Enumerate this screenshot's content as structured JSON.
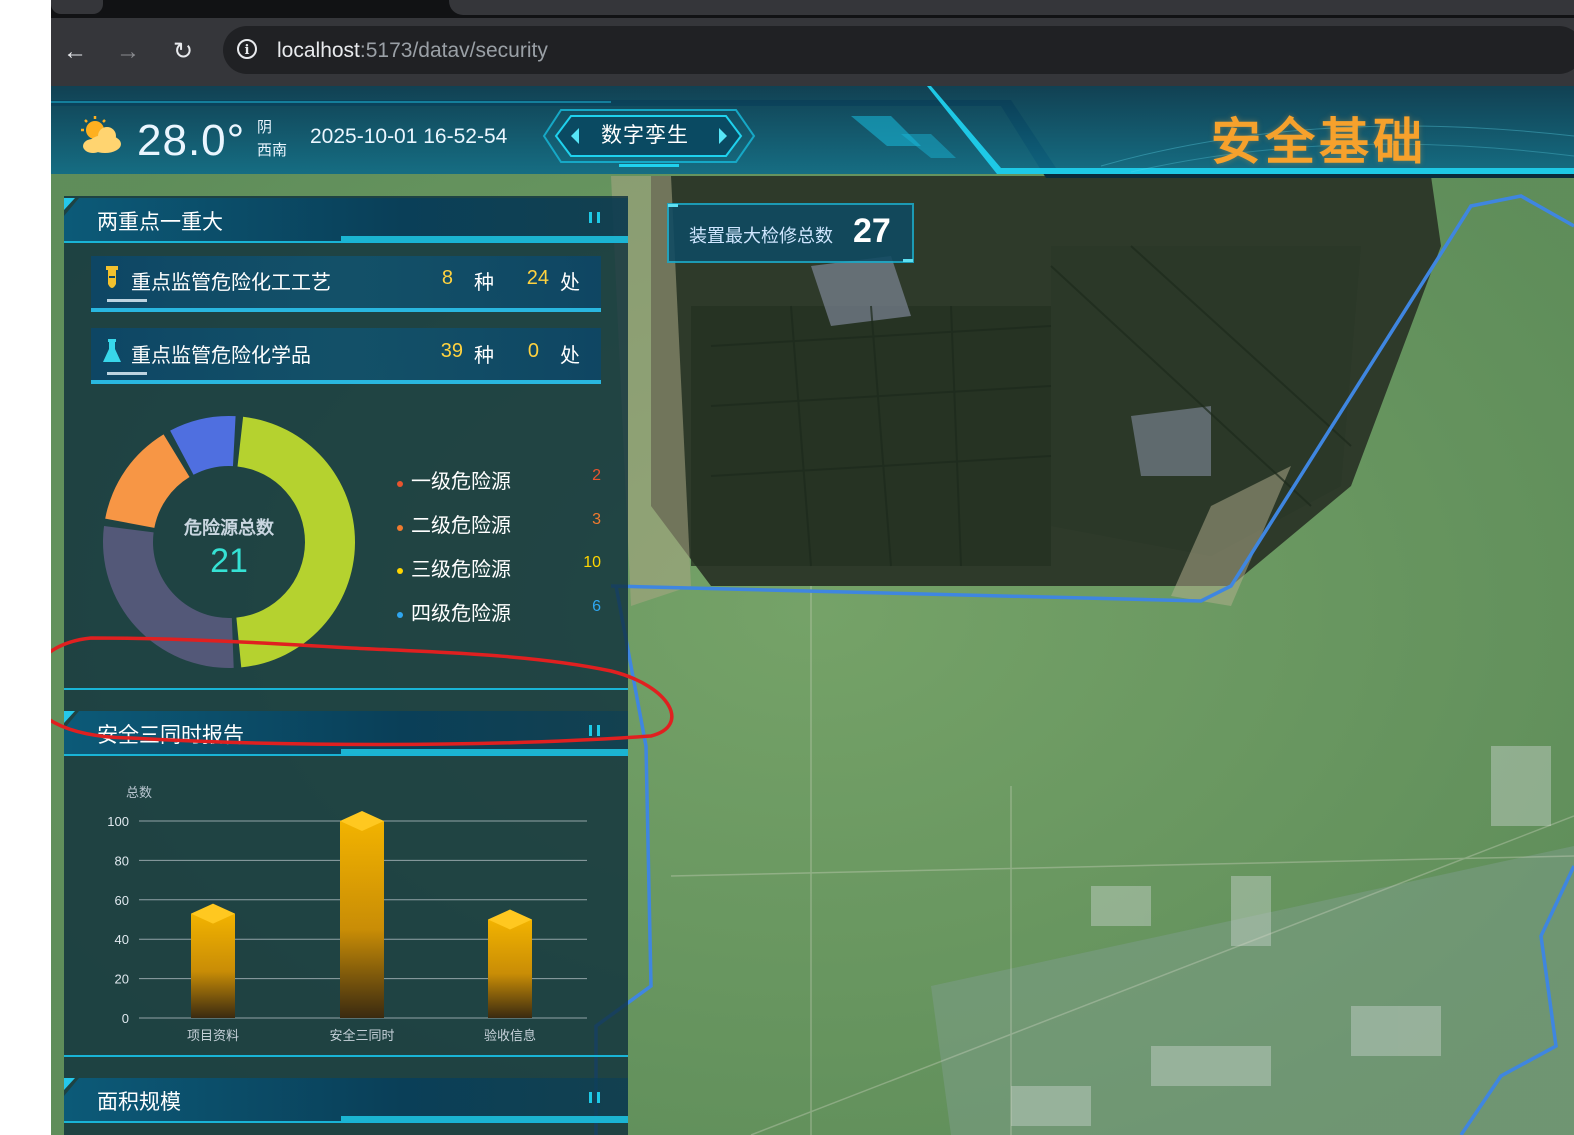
{
  "browser": {
    "url_host": "localhost",
    "url_path": ":5173/datav/security"
  },
  "header": {
    "weather_icon": "partly-cloudy-sun-icon",
    "temperature": "28.0°",
    "weather": "阴",
    "wind": "西南",
    "datetime": "2025-10-01 16-52-54",
    "twin_button": "数字孪生",
    "title": "安全基础"
  },
  "panel1": {
    "title": "两重点一重大",
    "rows": [
      {
        "icon": "test-tube-icon",
        "label": "重点监管危险化工工艺",
        "count1": "8",
        "unit1": "种",
        "count2": "24",
        "unit2": "处"
      },
      {
        "icon": "flask-icon",
        "label": "重点监管危险化学品",
        "count1": "39",
        "unit1": "种",
        "count2": "0",
        "unit2": "处"
      }
    ],
    "donut": {
      "center_label": "危险源总数",
      "center_value": "21",
      "legend": [
        {
          "name": "一级危险源",
          "value": "2",
          "color": "#e8542e"
        },
        {
          "name": "二级危险源",
          "value": "3",
          "color": "#f07a2e"
        },
        {
          "name": "三级危险源",
          "value": "10",
          "color": "#ffd500"
        },
        {
          "name": "四级危险源",
          "value": "6",
          "color": "#2fa6f0"
        }
      ],
      "segment_colors": [
        "#f79645",
        "#4f6fe0",
        "#b5d22f",
        "#535878"
      ]
    }
  },
  "stat": {
    "label": "装置最大检修总数",
    "value": "27"
  },
  "panel2": {
    "title": "安全三同时报告",
    "chart_data": {
      "type": "bar",
      "categories": [
        "项目资料",
        "安全三同时",
        "验收信息"
      ],
      "values": [
        53,
        100,
        50
      ],
      "ylabel": "总数",
      "ylim": [
        0,
        100
      ],
      "yticks": [
        0,
        20,
        40,
        60,
        80,
        100
      ],
      "grid": true
    }
  },
  "panel3": {
    "title": "面积规模"
  },
  "colors": {
    "accent_cyan": "#14c8e6",
    "title_orange": "#f6a12c",
    "bar_gold": "#f0b000",
    "boundary_blue": "#3f86e0",
    "annotation_red": "#e02020"
  }
}
